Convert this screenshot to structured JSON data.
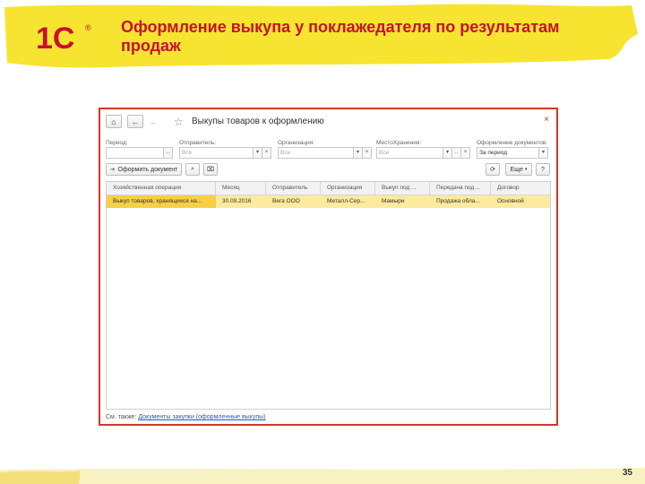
{
  "slide": {
    "title": "Оформление выкупа у поклажедателя по результатам продаж",
    "page_number": "35",
    "brand_color": "#c8102e",
    "accent_yellow": "#f6e430"
  },
  "window": {
    "title": "Выкупы товаров к оформлению",
    "close_icon": "close-icon",
    "filters": {
      "period_label": "Период:",
      "sender_label": "Отправитель:",
      "sender_value": "Все",
      "org_label": "Организация:",
      "org_value": "Все",
      "storage_label": "МестоХранения:",
      "storage_value": "Все",
      "docs_label": "Оформление документов:",
      "docs_value": "За период"
    },
    "toolbar": {
      "create_label": "Оформить документ",
      "more_label": "Еще",
      "help_label": "?"
    },
    "table": {
      "columns": [
        "Хозяйственная операция",
        "Месяц",
        "Отправитель",
        "Организация",
        "Выкуп под ...",
        "Передача под ...",
        "Договор"
      ],
      "rows": [
        [
          "Выкуп товаров, хранящихся на...",
          "30.09.2016",
          "Вега ООО",
          "Металл-Сер...",
          "Мамыри",
          "Продажа обла...",
          "Основной"
        ]
      ]
    },
    "see_also_label": "См. также:",
    "see_also_link": "Документы закупки (оформленные выкупы)"
  }
}
